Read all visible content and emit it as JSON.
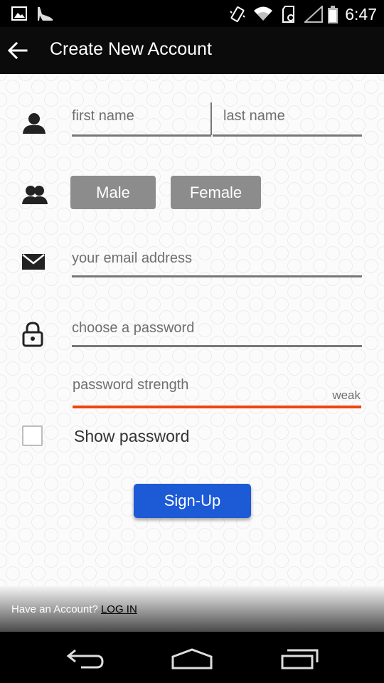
{
  "status_bar": {
    "time": "6:47",
    "icons": [
      "image-icon",
      "heel-shoe-icon",
      "vibrate-icon",
      "wifi-icon",
      "sd-card-icon",
      "signal-icon",
      "battery-icon"
    ]
  },
  "app_bar": {
    "title": "Create New Account",
    "back_icon": "arrow-left-icon"
  },
  "form": {
    "first_name_placeholder": "first name",
    "last_name_placeholder": "last name",
    "gender_options": [
      "Male",
      "Female"
    ],
    "email_placeholder": "your email address",
    "password_placeholder": "choose a password",
    "password_strength_label": "password strength",
    "password_strength_value": "weak",
    "password_strength_color": "#f0440f",
    "show_password_label": "Show password",
    "show_password_checked": false,
    "signup_label": "Sign-Up",
    "signup_color": "#1c5ad6"
  },
  "footer": {
    "have_account_text": "Have an Account?",
    "login_link": "LOG IN"
  },
  "nav_bar": {
    "buttons": [
      "back-nav-icon",
      "home-nav-icon",
      "recents-nav-icon"
    ]
  }
}
